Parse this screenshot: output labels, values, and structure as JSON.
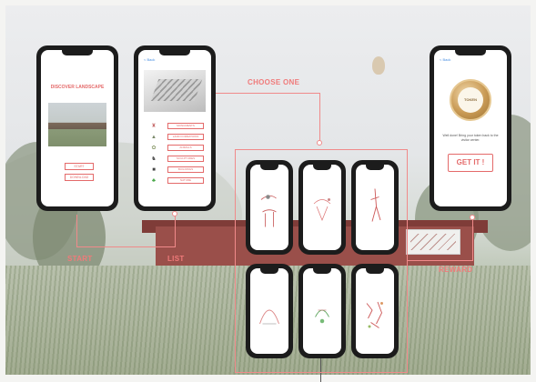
{
  "start_phone": {
    "title": "DISCOVER LANDSCAPE",
    "button_start": "START",
    "button_second": "DOWNLOAD"
  },
  "list_phone": {
    "back": "< Back",
    "items": [
      "MONUMENTS",
      "LAND FORMATIONS",
      "ANIMALS",
      "SCULPTURES",
      "BUILDINGS",
      "NATURE"
    ],
    "icons": [
      "landmark-icon",
      "landform-icon",
      "animal-icon",
      "sculpture-icon",
      "building-icon",
      "nature-icon"
    ]
  },
  "reward_phone": {
    "back": "< Back",
    "medal_text": "TOKEN",
    "message": "Well done! Bring your token back to the visitor center.",
    "button": "GET IT !"
  },
  "labels": {
    "start": "START",
    "list": "LIST",
    "choose": "CHOOSE ONE",
    "reward": "REWARD"
  },
  "colors": {
    "accent": "#e46a6a",
    "line": "#f08a8a"
  }
}
